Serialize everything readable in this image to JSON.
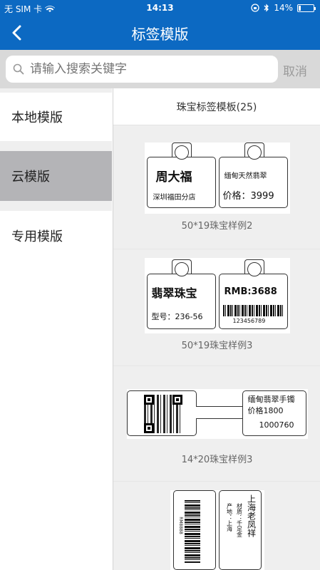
{
  "status_bar": {
    "carrier": "无 SIM 卡",
    "time": "14:13",
    "battery": "14%",
    "battery_level": 0.14
  },
  "nav": {
    "title": "标签模版",
    "back_icon": "chevron-left-icon"
  },
  "search": {
    "placeholder": "请输入搜索关键字",
    "cancel_label": "取消"
  },
  "sidebar": {
    "items": [
      {
        "label": "本地模版",
        "active": false
      },
      {
        "label": "云模版",
        "active": true
      },
      {
        "label": "专用模版",
        "active": false
      }
    ]
  },
  "content": {
    "header": "珠宝标签模板(25)",
    "templates": [
      {
        "name": "50*19珠宝样例2",
        "left": {
          "line1": "周大福",
          "line2": "深圳福田分店"
        },
        "right": {
          "line1": "缅甸天然翡翠",
          "line2": "价格：3999"
        }
      },
      {
        "name": "50*19珠宝样例3",
        "left": {
          "line1": "翡翠珠宝",
          "line2": "型号：236-56"
        },
        "right": {
          "line1": "RMB:3688",
          "barcode_text": "123456789"
        }
      },
      {
        "name": "14*20珠宝样例3",
        "right": {
          "line1": "缅甸翡翠手镯",
          "line2": "价格1800",
          "line3": "1000760"
        }
      },
      {
        "name": "",
        "left": {
          "barcode_text": "RM8888"
        },
        "right": {
          "line1": "上海老凤祥",
          "line2": "材质：千足金",
          "line3": "产地：上海"
        }
      }
    ]
  },
  "colors": {
    "header": "#0c69c2",
    "active_sidebar": "#b4b4b7",
    "search_bg": "#d9d9d9"
  }
}
